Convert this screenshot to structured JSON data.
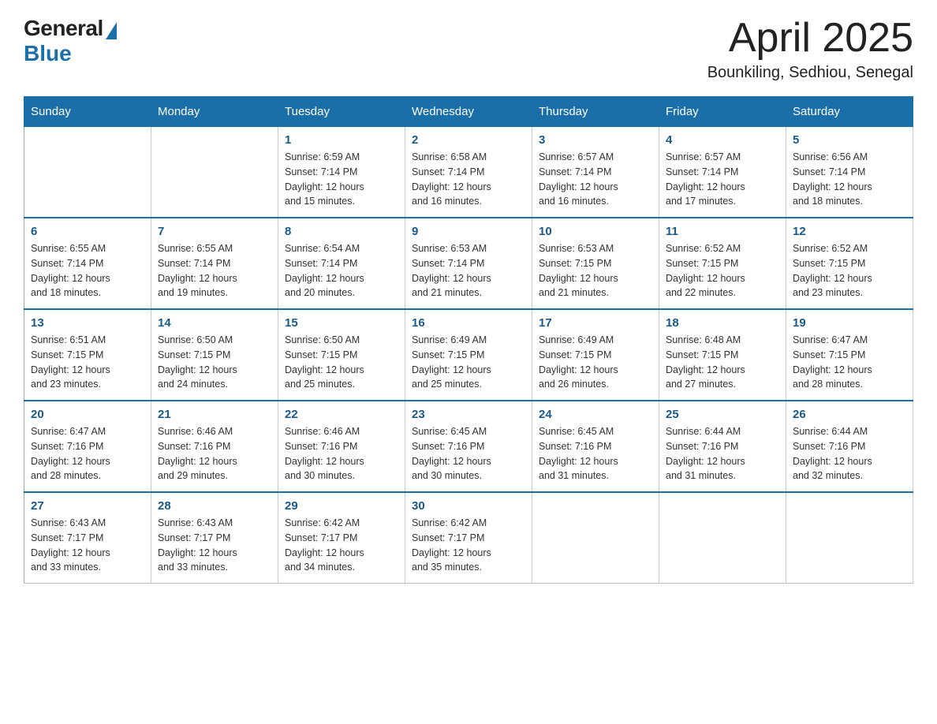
{
  "header": {
    "logo_general": "General",
    "logo_blue": "Blue",
    "month_year": "April 2025",
    "location": "Bounkiling, Sedhiou, Senegal"
  },
  "days_of_week": [
    "Sunday",
    "Monday",
    "Tuesday",
    "Wednesday",
    "Thursday",
    "Friday",
    "Saturday"
  ],
  "weeks": [
    [
      {
        "day": "",
        "info": ""
      },
      {
        "day": "",
        "info": ""
      },
      {
        "day": "1",
        "info": "Sunrise: 6:59 AM\nSunset: 7:14 PM\nDaylight: 12 hours\nand 15 minutes."
      },
      {
        "day": "2",
        "info": "Sunrise: 6:58 AM\nSunset: 7:14 PM\nDaylight: 12 hours\nand 16 minutes."
      },
      {
        "day": "3",
        "info": "Sunrise: 6:57 AM\nSunset: 7:14 PM\nDaylight: 12 hours\nand 16 minutes."
      },
      {
        "day": "4",
        "info": "Sunrise: 6:57 AM\nSunset: 7:14 PM\nDaylight: 12 hours\nand 17 minutes."
      },
      {
        "day": "5",
        "info": "Sunrise: 6:56 AM\nSunset: 7:14 PM\nDaylight: 12 hours\nand 18 minutes."
      }
    ],
    [
      {
        "day": "6",
        "info": "Sunrise: 6:55 AM\nSunset: 7:14 PM\nDaylight: 12 hours\nand 18 minutes."
      },
      {
        "day": "7",
        "info": "Sunrise: 6:55 AM\nSunset: 7:14 PM\nDaylight: 12 hours\nand 19 minutes."
      },
      {
        "day": "8",
        "info": "Sunrise: 6:54 AM\nSunset: 7:14 PM\nDaylight: 12 hours\nand 20 minutes."
      },
      {
        "day": "9",
        "info": "Sunrise: 6:53 AM\nSunset: 7:14 PM\nDaylight: 12 hours\nand 21 minutes."
      },
      {
        "day": "10",
        "info": "Sunrise: 6:53 AM\nSunset: 7:15 PM\nDaylight: 12 hours\nand 21 minutes."
      },
      {
        "day": "11",
        "info": "Sunrise: 6:52 AM\nSunset: 7:15 PM\nDaylight: 12 hours\nand 22 minutes."
      },
      {
        "day": "12",
        "info": "Sunrise: 6:52 AM\nSunset: 7:15 PM\nDaylight: 12 hours\nand 23 minutes."
      }
    ],
    [
      {
        "day": "13",
        "info": "Sunrise: 6:51 AM\nSunset: 7:15 PM\nDaylight: 12 hours\nand 23 minutes."
      },
      {
        "day": "14",
        "info": "Sunrise: 6:50 AM\nSunset: 7:15 PM\nDaylight: 12 hours\nand 24 minutes."
      },
      {
        "day": "15",
        "info": "Sunrise: 6:50 AM\nSunset: 7:15 PM\nDaylight: 12 hours\nand 25 minutes."
      },
      {
        "day": "16",
        "info": "Sunrise: 6:49 AM\nSunset: 7:15 PM\nDaylight: 12 hours\nand 25 minutes."
      },
      {
        "day": "17",
        "info": "Sunrise: 6:49 AM\nSunset: 7:15 PM\nDaylight: 12 hours\nand 26 minutes."
      },
      {
        "day": "18",
        "info": "Sunrise: 6:48 AM\nSunset: 7:15 PM\nDaylight: 12 hours\nand 27 minutes."
      },
      {
        "day": "19",
        "info": "Sunrise: 6:47 AM\nSunset: 7:15 PM\nDaylight: 12 hours\nand 28 minutes."
      }
    ],
    [
      {
        "day": "20",
        "info": "Sunrise: 6:47 AM\nSunset: 7:16 PM\nDaylight: 12 hours\nand 28 minutes."
      },
      {
        "day": "21",
        "info": "Sunrise: 6:46 AM\nSunset: 7:16 PM\nDaylight: 12 hours\nand 29 minutes."
      },
      {
        "day": "22",
        "info": "Sunrise: 6:46 AM\nSunset: 7:16 PM\nDaylight: 12 hours\nand 30 minutes."
      },
      {
        "day": "23",
        "info": "Sunrise: 6:45 AM\nSunset: 7:16 PM\nDaylight: 12 hours\nand 30 minutes."
      },
      {
        "day": "24",
        "info": "Sunrise: 6:45 AM\nSunset: 7:16 PM\nDaylight: 12 hours\nand 31 minutes."
      },
      {
        "day": "25",
        "info": "Sunrise: 6:44 AM\nSunset: 7:16 PM\nDaylight: 12 hours\nand 31 minutes."
      },
      {
        "day": "26",
        "info": "Sunrise: 6:44 AM\nSunset: 7:16 PM\nDaylight: 12 hours\nand 32 minutes."
      }
    ],
    [
      {
        "day": "27",
        "info": "Sunrise: 6:43 AM\nSunset: 7:17 PM\nDaylight: 12 hours\nand 33 minutes."
      },
      {
        "day": "28",
        "info": "Sunrise: 6:43 AM\nSunset: 7:17 PM\nDaylight: 12 hours\nand 33 minutes."
      },
      {
        "day": "29",
        "info": "Sunrise: 6:42 AM\nSunset: 7:17 PM\nDaylight: 12 hours\nand 34 minutes."
      },
      {
        "day": "30",
        "info": "Sunrise: 6:42 AM\nSunset: 7:17 PM\nDaylight: 12 hours\nand 35 minutes."
      },
      {
        "day": "",
        "info": ""
      },
      {
        "day": "",
        "info": ""
      },
      {
        "day": "",
        "info": ""
      }
    ]
  ]
}
